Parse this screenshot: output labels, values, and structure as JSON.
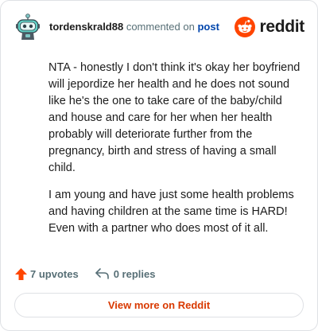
{
  "header": {
    "username": "tordenskrald88",
    "verb": "commented on",
    "post_link": "post",
    "brand": "reddit",
    "avatar_icon": "snoo-robot-avatar-icon",
    "logo_icon": "reddit-snoo-logo-icon"
  },
  "comment": {
    "paragraphs": [
      "NTA - honestly I don't think it's okay her boyfriend will jepordize her health and he does not sound like he's the one to take care of the baby/child and house and care for her when her health probably will deteriorate further from the pregnancy, birth and stress of having a small child.",
      "I am young and have just some health problems and having children at the same time is HARD! Even with a partner who does most of it all."
    ]
  },
  "actions": {
    "upvotes": "7 upvotes",
    "replies": "0 replies",
    "upvote_icon": "upvote-arrow-icon",
    "reply_icon": "reply-arrow-icon"
  },
  "footer": {
    "view_more": "View more on Reddit"
  },
  "colors": {
    "brand_orange": "#ff4500",
    "link_blue": "#0045ac",
    "muted": "#576f76",
    "view_more_text": "#d93900",
    "border": "#dfe1e5"
  }
}
